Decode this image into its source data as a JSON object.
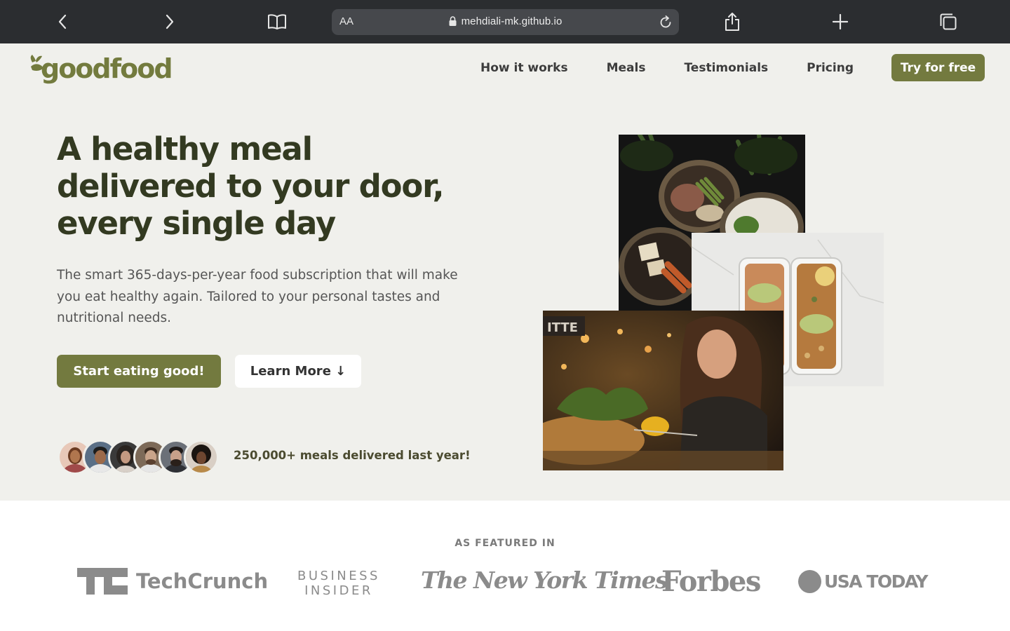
{
  "browser": {
    "url": "mehdiali-mk.github.io",
    "text_size_label": "AA"
  },
  "nav": {
    "logo": "goodfood",
    "links": [
      "How it works",
      "Meals",
      "Testimonials",
      "Pricing"
    ],
    "cta": "Try for free"
  },
  "hero": {
    "headline": "A healthy meal delivered to your door, every single day",
    "description": "The smart 365-days-per-year food subscription that will make you eat healthy again. Tailored to your personal tastes and nutritional needs.",
    "primary_button": "Start eating good!",
    "secondary_button": "Learn More ↓",
    "delivered_text": "250,000+ meals delivered last year!"
  },
  "featured": {
    "title": "AS FEATURED IN",
    "logos": [
      "TechCrunch",
      "BUSINESS",
      "INSIDER",
      "The New York Times",
      "Forbes",
      "USA TODAY"
    ]
  },
  "colors": {
    "brand": "#737a3f",
    "hero_bg": "#f0f0ec",
    "chrome_bg": "#2b2d30"
  }
}
